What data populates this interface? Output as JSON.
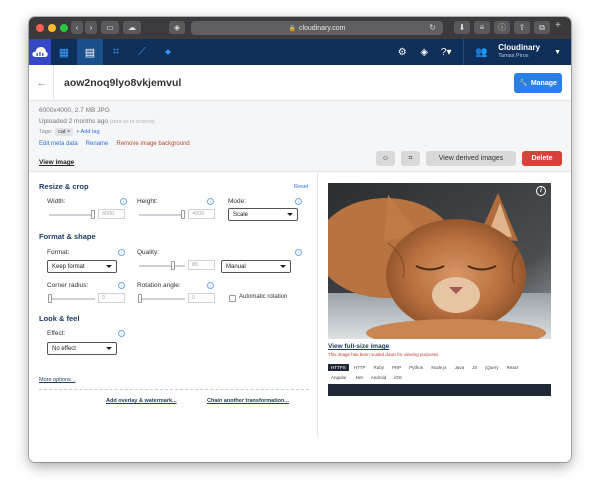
{
  "browser": {
    "url": "cloudinary.com"
  },
  "nav": {
    "account_name": "Cloudinary",
    "account_user": "Tamas Piros"
  },
  "header": {
    "title": "aow2noq9lyo8vkjemvul",
    "manage_label": "Manage"
  },
  "meta": {
    "dims": "6000x4000, 2.7 MB JPG",
    "uploaded": "Uploaded 2 months ago",
    "uploaded_ts": "(2019-10-10 10:00:00)",
    "tags_label": "Tags:",
    "tag": "cat",
    "tag_x": "×",
    "add_tag": "+ Add tag",
    "links": {
      "edit_meta": "Edit meta data",
      "rename": "Rename",
      "remove_bg": "Remove image background"
    },
    "view_image": "View image",
    "view_derived": "View derived images",
    "delete": "Delete"
  },
  "transform": {
    "resize_title": "Resize & crop",
    "reset": "Reset",
    "width_label": "Width:",
    "width_value": "6000",
    "height_label": "Height:",
    "height_value": "4000",
    "mode_label": "Mode:",
    "mode_value": "Scale",
    "format_title": "Format & shape",
    "format_label": "Format:",
    "format_value": "Keep format",
    "quality_label": "Quality:",
    "quality_value": "80",
    "quality_mode": "Manual",
    "corner_label": "Corner radius:",
    "corner_value": "0",
    "rotation_label": "Rotation angle:",
    "rotation_value": "0",
    "auto_rotation": "Automatic rotation",
    "look_title": "Look & feel",
    "effect_label": "Effect:",
    "effect_value": "No effect",
    "more_options": "More options...",
    "add_overlay": "Add overlay & watermark...",
    "chain": "Chain another transformation..."
  },
  "preview": {
    "view_full": "View full-size image",
    "scaled_note": "This image has been scaled down for viewing purposes",
    "tabs_row1": [
      "HTTPS",
      "HTTP",
      "Ruby",
      "PHP",
      "Python",
      "Node.js",
      "Java",
      "JS",
      "jQuery",
      "React"
    ],
    "tabs_row2": [
      "Angular",
      ".Net",
      "Android",
      "iOS"
    ],
    "info_glyph": "i"
  },
  "colors": {
    "nav_bg": "#0e2f5a",
    "accent": "#2d7fe8",
    "delete": "#d9413b",
    "section": "#1f3b67"
  }
}
